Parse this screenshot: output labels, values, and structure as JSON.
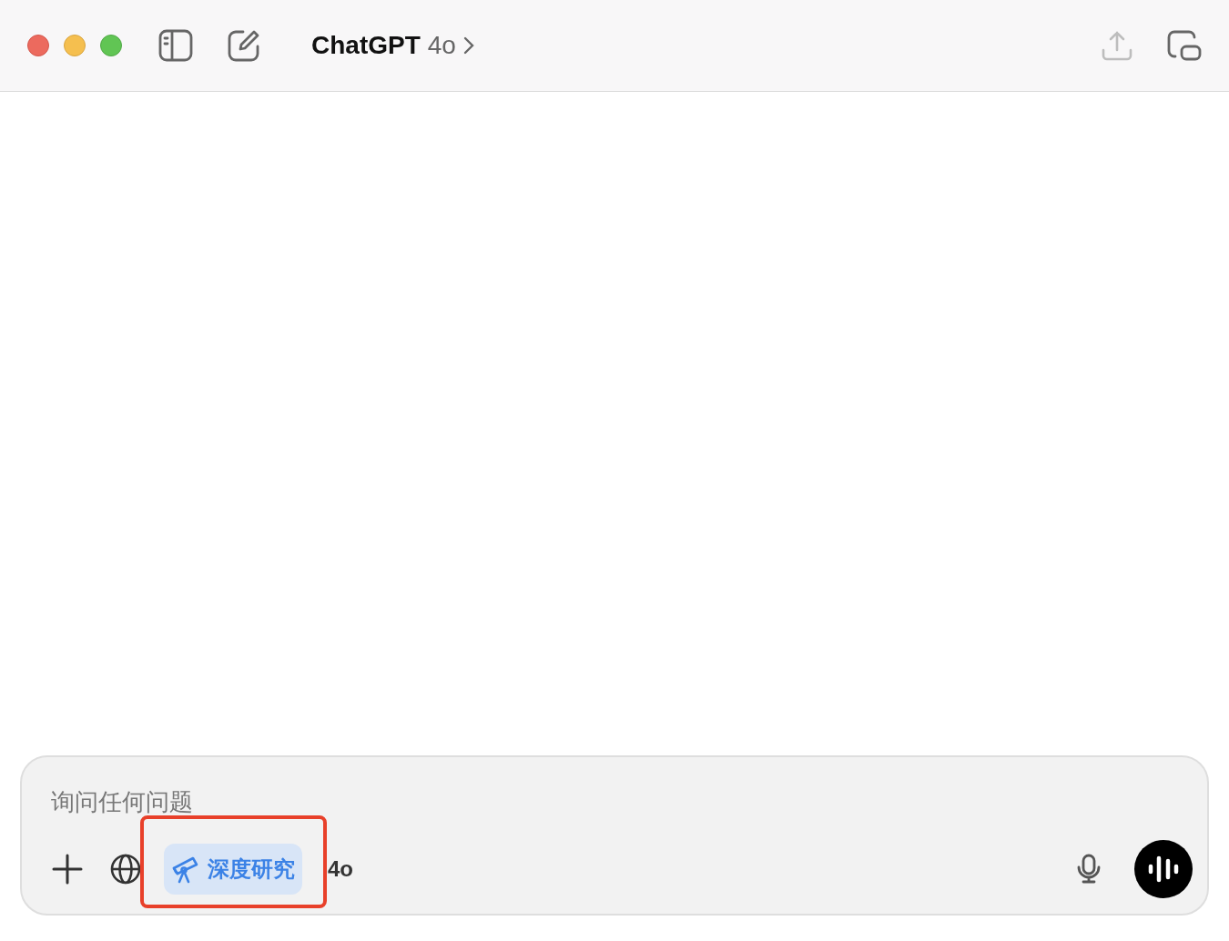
{
  "window": {
    "title": "ChatGPT",
    "model": "4o"
  },
  "composer": {
    "placeholder": "询问任何问题",
    "tools": [
      {
        "kind": "add"
      },
      {
        "kind": "web"
      },
      {
        "kind": "deep_research",
        "label": "深度研究",
        "selected": true,
        "highlighted": true
      }
    ],
    "model_label": "4o"
  }
}
